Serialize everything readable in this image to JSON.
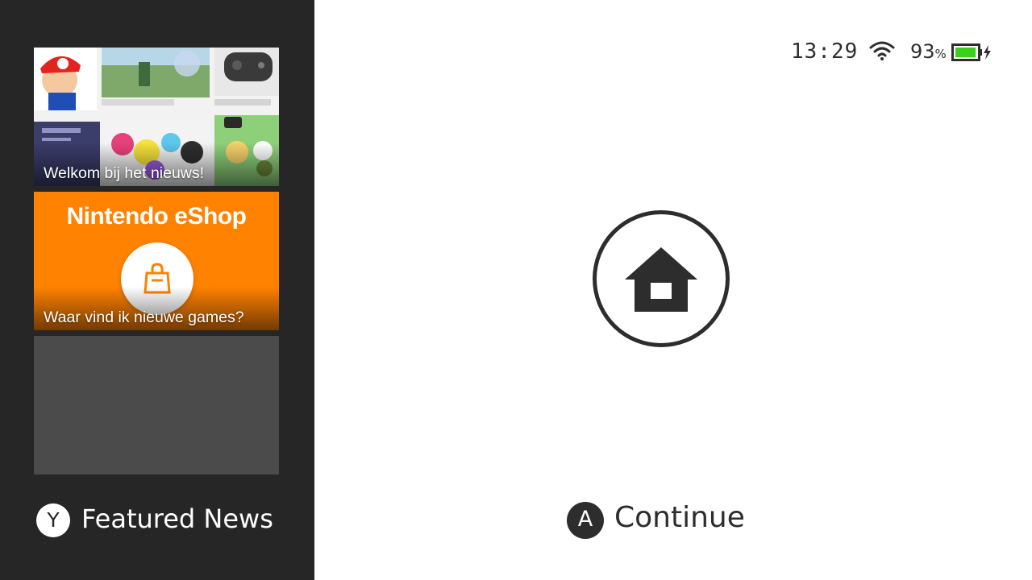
{
  "sidebar": {
    "cards": [
      {
        "label": "Welkom bij het nieuws!"
      },
      {
        "title": "Nintendo eShop",
        "label": "Waar vind ik nieuwe games?"
      },
      {
        "label": ""
      }
    ],
    "y_button": "Y",
    "featured_label": "Featured News"
  },
  "status": {
    "time": "13:29",
    "battery_percent": "93",
    "battery_unit": "%",
    "battery_level": 0.93,
    "charging": true,
    "wifi_icon": "wifi-icon"
  },
  "main": {
    "home_icon": "home-icon",
    "a_button": "A",
    "continue_label": "Continue"
  },
  "colors": {
    "sidebar_bg": "#262626",
    "eshop_orange": "#ff8200",
    "battery_green": "#39d11a",
    "text_dark": "#2d2d2d"
  }
}
